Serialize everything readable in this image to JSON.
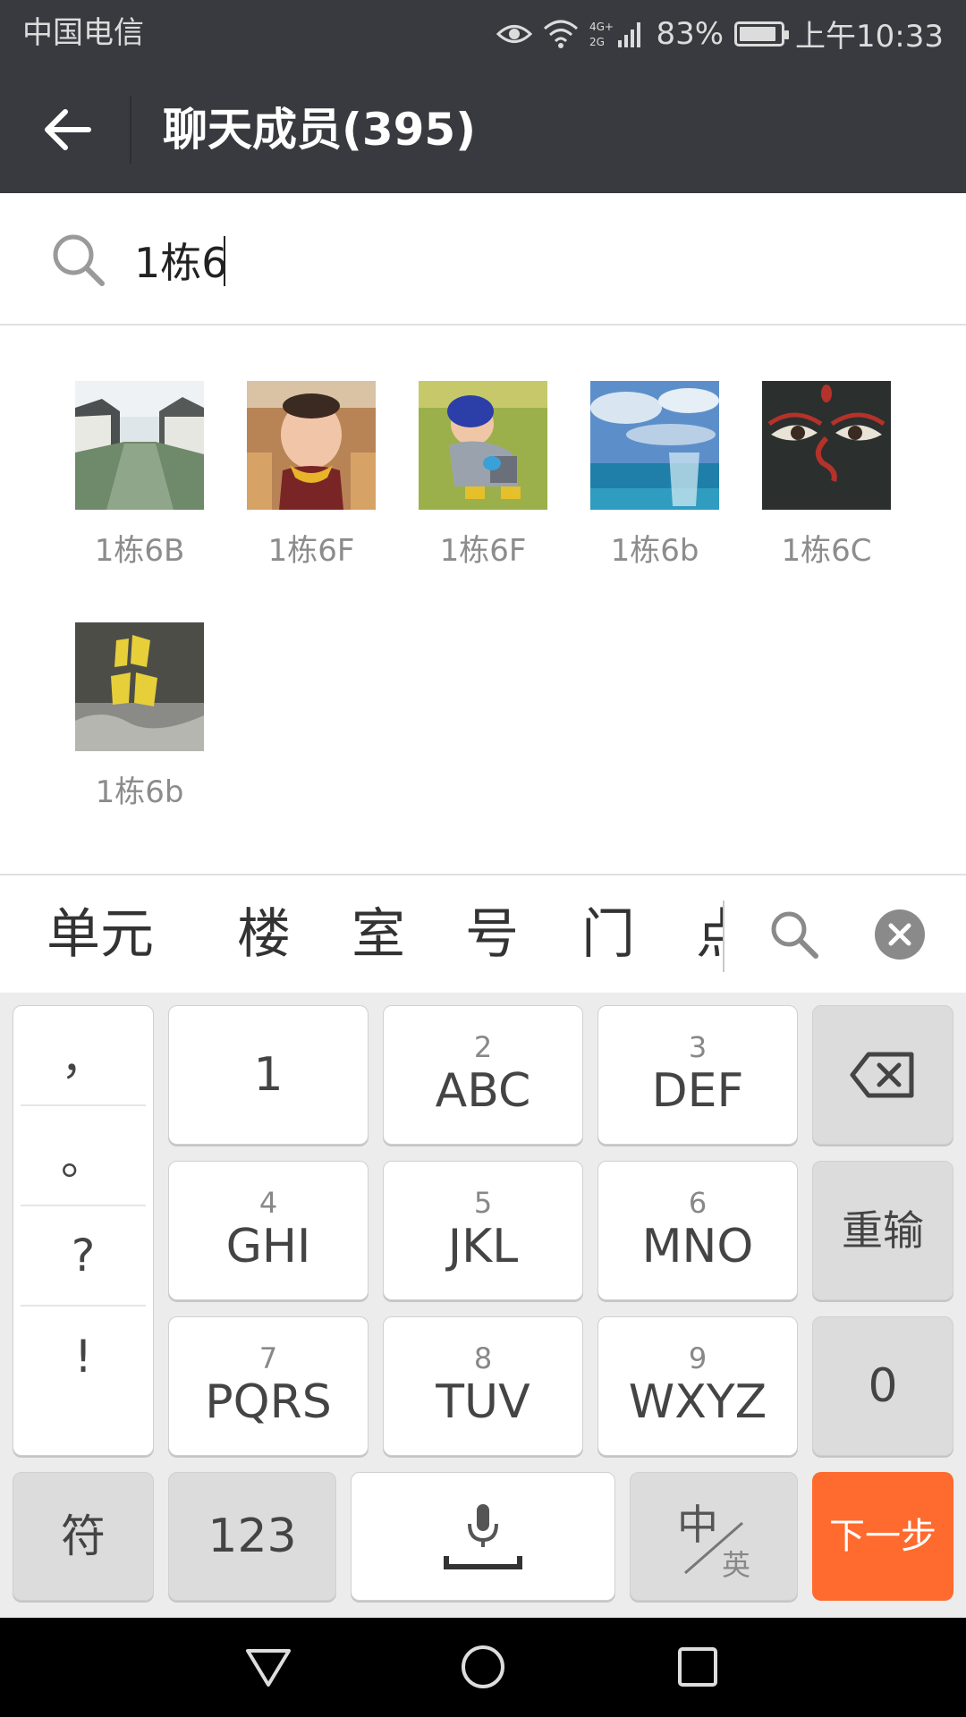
{
  "status_bar": {
    "carrier": "中国电信",
    "network": "4G+ 2G",
    "battery": "83%",
    "battery_level": 0.83,
    "time": "上午10:33"
  },
  "title_bar": {
    "title": "聊天成员(395)"
  },
  "search": {
    "value": "1栋6",
    "placeholder": ""
  },
  "members": [
    {
      "name": "1栋6B",
      "avatar": "canal-town-photo"
    },
    {
      "name": "1栋6F",
      "avatar": "baby-photo"
    },
    {
      "name": "1栋6F",
      "avatar": "child-on-grass-photo"
    },
    {
      "name": "1栋6b",
      "avatar": "sea-glass-photo"
    },
    {
      "name": "1栋6C",
      "avatar": "eyes-painting"
    },
    {
      "name": "1栋6b",
      "avatar": "calligraphy-poster"
    }
  ],
  "candidates": [
    "单元",
    "楼",
    "室",
    "号",
    "门",
    "点"
  ],
  "keyboard": {
    "punctuation": [
      "，",
      "。",
      "?",
      "!"
    ],
    "keys": [
      {
        "num": "",
        "main": "1"
      },
      {
        "num": "2",
        "main": "ABC"
      },
      {
        "num": "3",
        "main": "DEF"
      },
      {
        "num": "4",
        "main": "GHI"
      },
      {
        "num": "5",
        "main": "JKL"
      },
      {
        "num": "6",
        "main": "MNO"
      },
      {
        "num": "7",
        "main": "PQRS"
      },
      {
        "num": "8",
        "main": "TUV"
      },
      {
        "num": "9",
        "main": "WXYZ"
      }
    ],
    "reset": "重输",
    "zero": "0",
    "symbols": "符",
    "numbers": "123",
    "lang_main": "中",
    "lang_sub": "英",
    "next": "下一步"
  },
  "colors": {
    "header": "#393a3f",
    "accent": "#ff6a2e",
    "keyboard_bg": "#ececec"
  }
}
